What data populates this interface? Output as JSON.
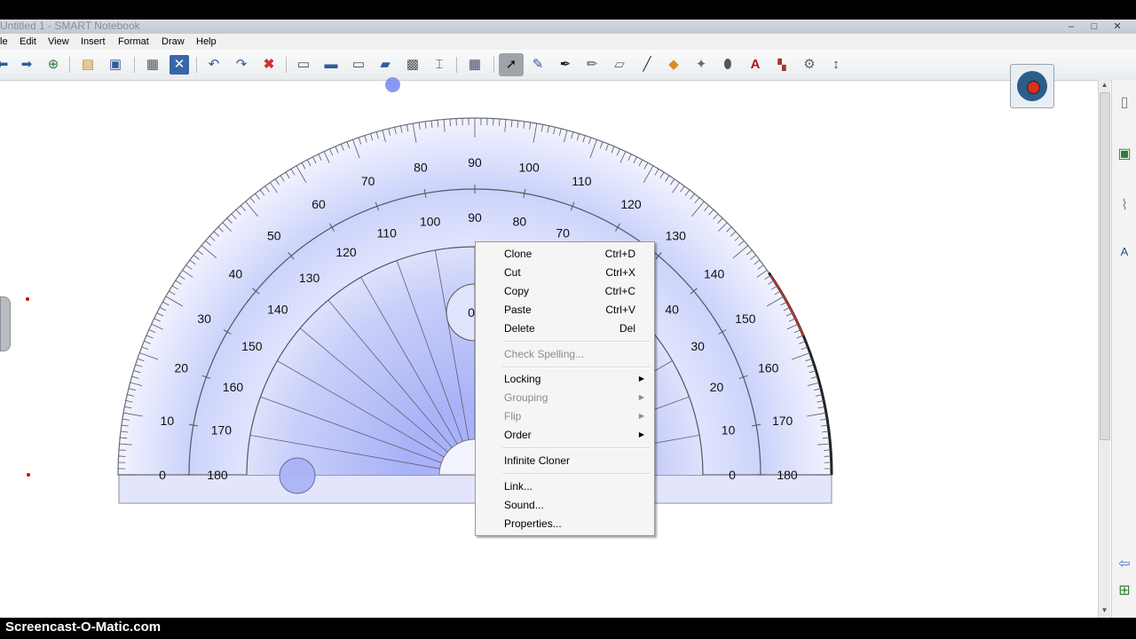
{
  "window": {
    "title": "Untitled 1 - SMART Notebook",
    "controls": [
      "–",
      "□",
      "✕"
    ]
  },
  "menu": [
    "le",
    "Edit",
    "View",
    "Insert",
    "Format",
    "Draw",
    "Help"
  ],
  "toolbar": {
    "icons": [
      "previous-page-icon",
      "next-page-icon",
      "add-page-icon",
      "open-file-icon",
      "save-icon",
      "paste-icon",
      "delete-icon",
      "undo-icon",
      "redo-icon",
      "clear-icon",
      "screen-shade-icon",
      "full-screen-icon",
      "transparent-background-icon",
      "dual-page-icon",
      "screen-capture-icon",
      "document-camera-icon",
      "table-icon",
      "select-icon",
      "pen-icon",
      "creative-pen-icon",
      "highlighter-icon",
      "eraser-icon",
      "line-icon",
      "shapes-icon",
      "magic-pen-icon",
      "fill-icon",
      "text-icon",
      "properties-icon",
      "measurement-tools-icon",
      "move-toolbar-icon"
    ]
  },
  "protractor": {
    "outer_labels_left": [
      "0",
      "10",
      "20",
      "30",
      "40",
      "50",
      "60",
      "70",
      "80",
      "90",
      "100",
      "110",
      "120",
      "130",
      "140",
      "150",
      "160",
      "170",
      "180"
    ],
    "inner_labels": [
      "180",
      "170",
      "160",
      "150",
      "140",
      "130",
      "120",
      "110",
      "100",
      "90",
      "80",
      "70",
      "60",
      "50",
      "40",
      "30",
      "20",
      "10",
      "0"
    ],
    "center_label": "0"
  },
  "context_menu": {
    "items": [
      {
        "label": "Clone",
        "shortcut": "Ctrl+D",
        "enabled": true
      },
      {
        "label": "Cut",
        "shortcut": "Ctrl+X",
        "enabled": true
      },
      {
        "label": "Copy",
        "shortcut": "Ctrl+C",
        "enabled": true
      },
      {
        "label": "Paste",
        "shortcut": "Ctrl+V",
        "enabled": true
      },
      {
        "label": "Delete",
        "shortcut": "Del",
        "enabled": true
      },
      {
        "label": "Check Spelling...",
        "enabled": false
      },
      {
        "label": "Locking",
        "submenu": true,
        "enabled": true
      },
      {
        "label": "Grouping",
        "submenu": true,
        "enabled": false
      },
      {
        "label": "Flip",
        "submenu": true,
        "enabled": false
      },
      {
        "label": "Order",
        "submenu": true,
        "enabled": true
      },
      {
        "label": "Infinite Cloner",
        "enabled": true
      },
      {
        "label": "Link...",
        "enabled": true
      },
      {
        "label": "Sound...",
        "enabled": true
      },
      {
        "label": "Properties...",
        "enabled": true
      }
    ]
  },
  "watermark": "Screencast-O-Matic.com"
}
